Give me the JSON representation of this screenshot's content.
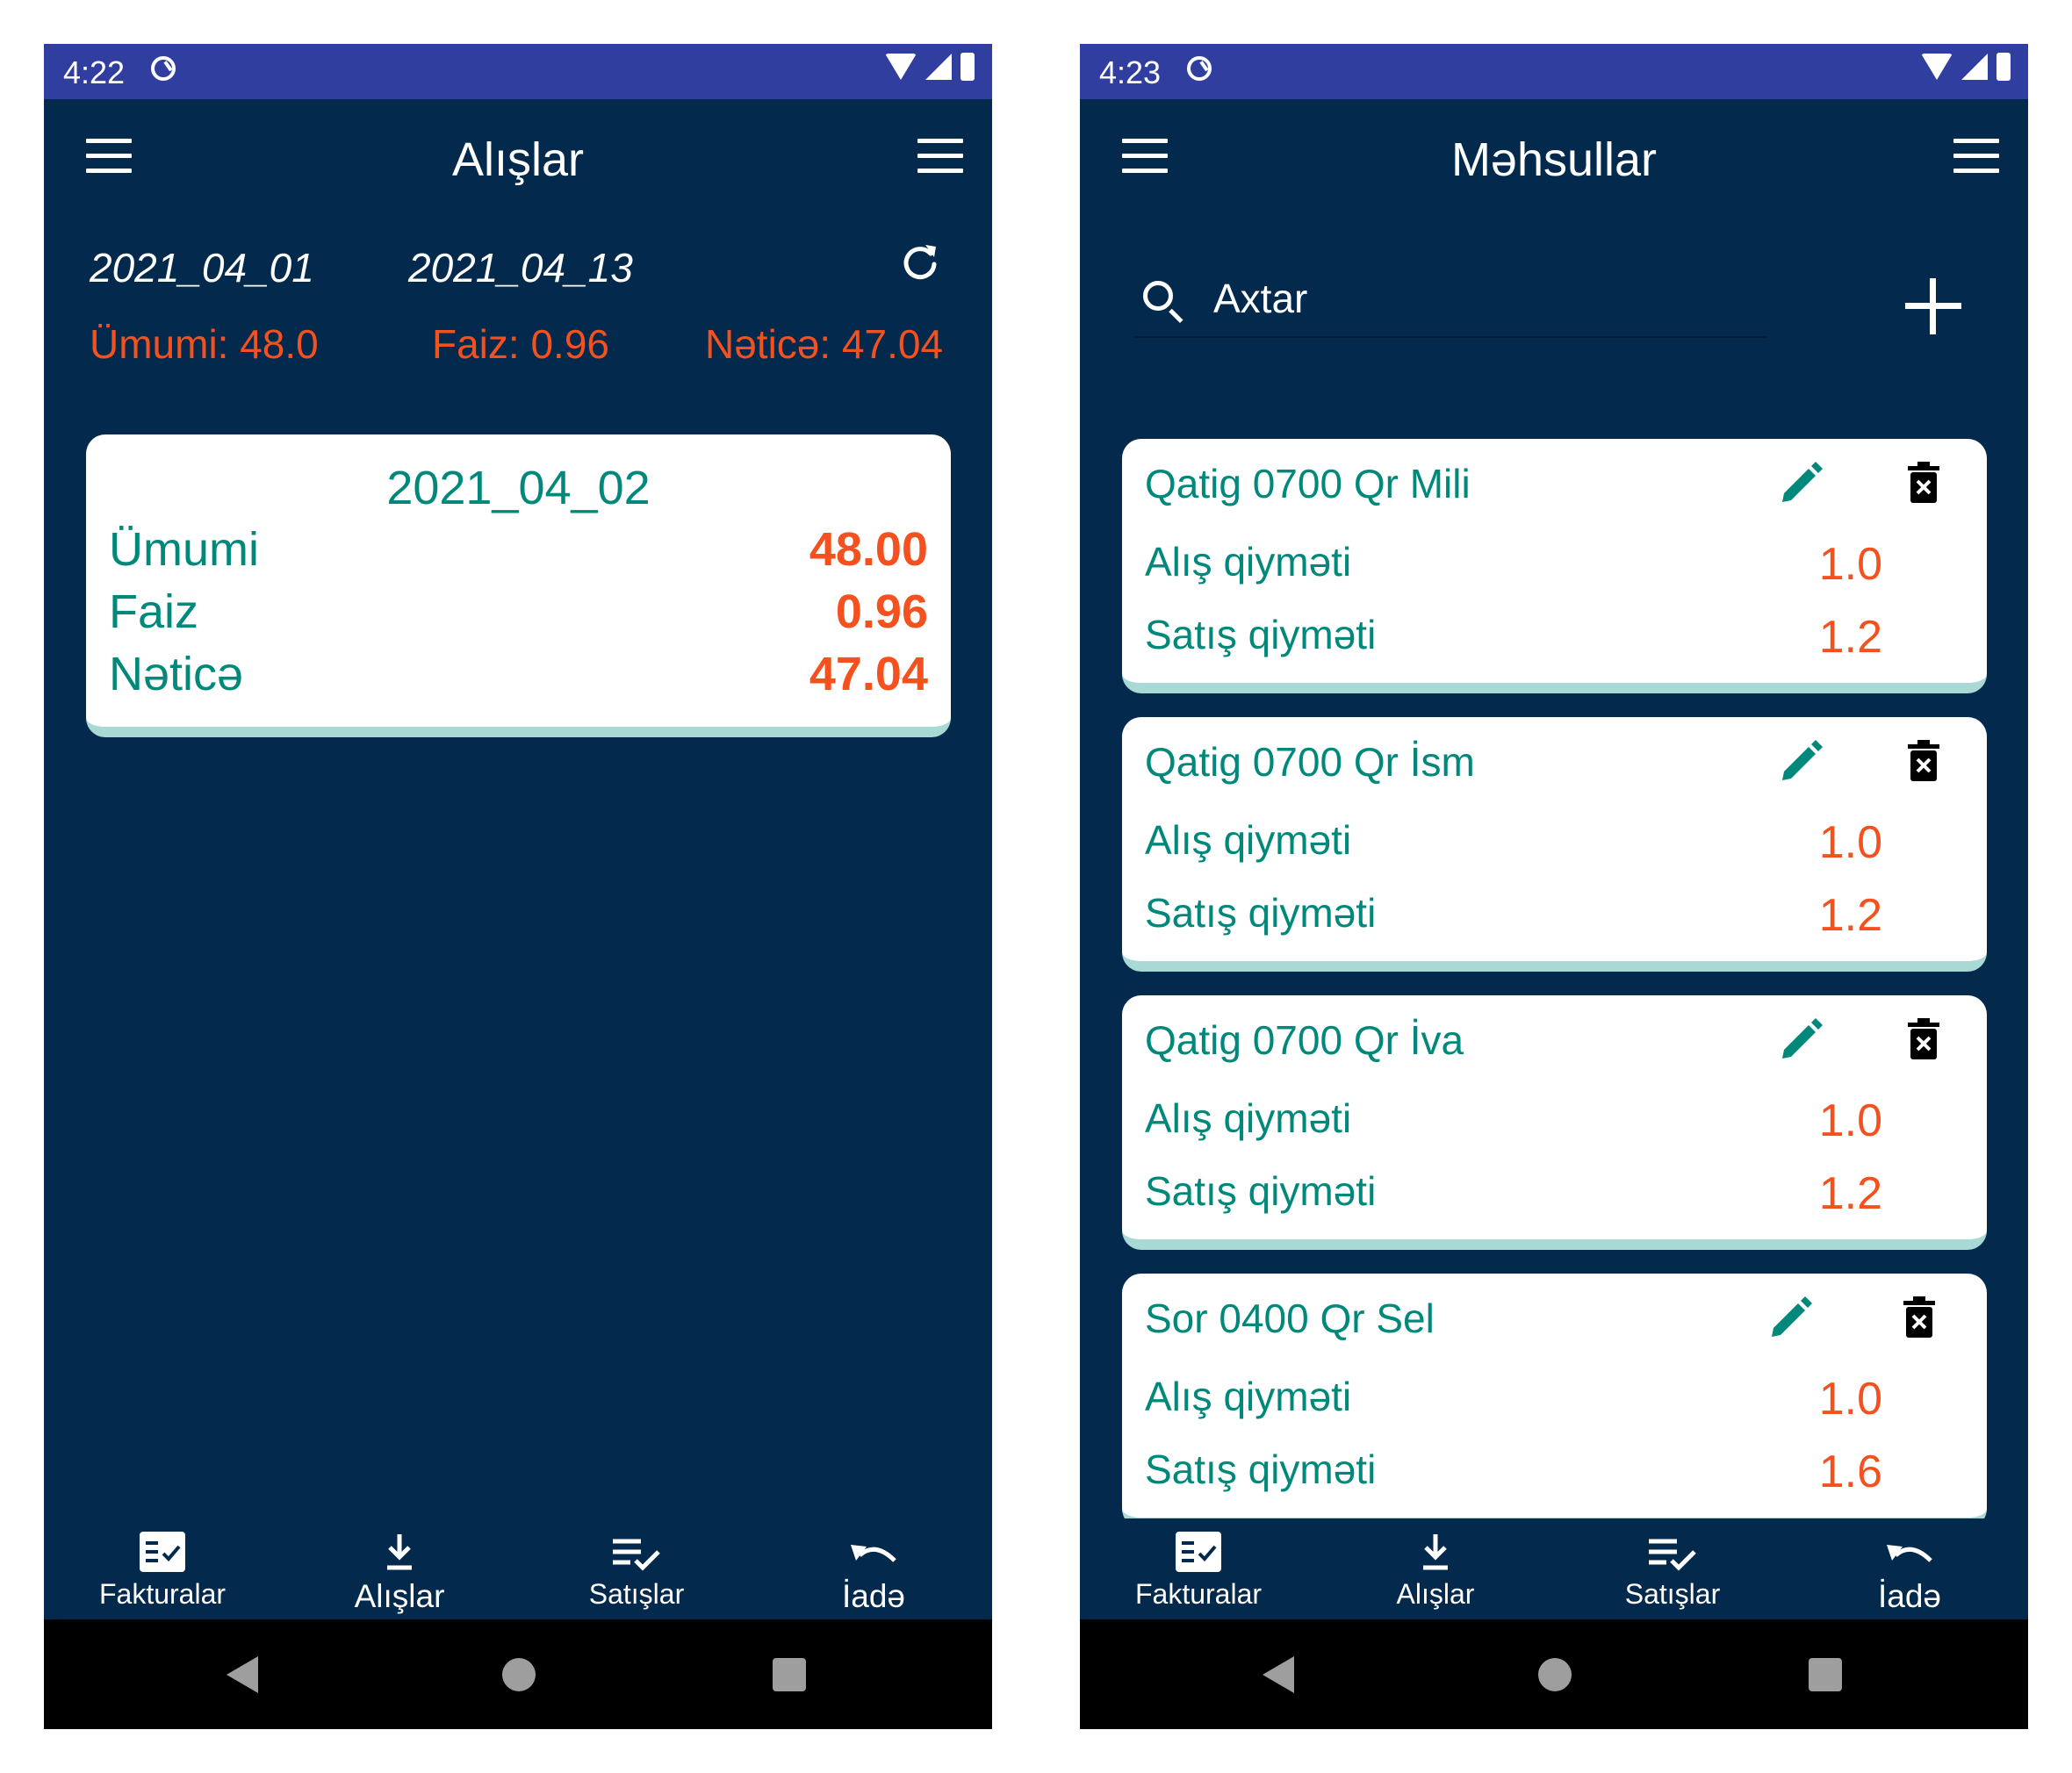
{
  "left": {
    "status": {
      "time": "4:22"
    },
    "appbar": {
      "title": "Alışlar"
    },
    "filters": {
      "date_from": "2021_04_01",
      "date_to": "2021_04_13"
    },
    "summary": {
      "total": "Ümumi: 48.0",
      "percent": "Faiz: 0.96",
      "result": "Nəticə: 47.04"
    },
    "invoice": {
      "date": "2021_04_02",
      "rows": [
        {
          "label": "Ümumi",
          "value": "48.00"
        },
        {
          "label": "Faiz",
          "value": "0.96"
        },
        {
          "label": "Nəticə",
          "value": "47.04"
        }
      ]
    }
  },
  "right": {
    "status": {
      "time": "4:23"
    },
    "appbar": {
      "title": "Məhsullar"
    },
    "search": {
      "placeholder": "Axtar"
    },
    "products": [
      {
        "name": "Qatig 0700 Qr Mili",
        "buy_label": "Alış qiyməti",
        "buy": "1.0",
        "sell_label": "Satış qiyməti",
        "sell": "1.2"
      },
      {
        "name": "Qatig 0700 Qr İsm",
        "buy_label": "Alış qiyməti",
        "buy": "1.0",
        "sell_label": "Satış qiyməti",
        "sell": "1.2"
      },
      {
        "name": "Qatig 0700 Qr İva",
        "buy_label": "Alış qiyməti",
        "buy": "1.0",
        "sell_label": "Satış qiyməti",
        "sell": "1.2"
      },
      {
        "name": "Sor 0400 Qr Sel",
        "buy_label": "Alış qiyməti",
        "buy": "1.0",
        "sell_label": "Satış qiyməti",
        "sell": "1.6"
      }
    ]
  },
  "nav": {
    "items": [
      {
        "label": "Fakturalar",
        "icon": "invoice-icon"
      },
      {
        "label": "Alışlar",
        "icon": "download-icon"
      },
      {
        "label": "Satışlar",
        "icon": "checklist-icon"
      },
      {
        "label": "İadə",
        "icon": "undo-icon"
      }
    ]
  },
  "colors": {
    "background": "#03294c",
    "statusbar": "#303f9f",
    "accent_teal": "#00897b",
    "accent_orange": "#f4511e",
    "card_border": "#a8d9d5"
  }
}
